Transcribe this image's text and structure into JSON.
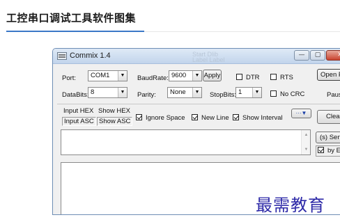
{
  "page": {
    "title": "工控串口调试工具软件图集",
    "accent_color": "#3b78c7"
  },
  "window": {
    "title": "Commix 1.4",
    "icon": "terminal-app-icon",
    "controls": {
      "minimize": "—",
      "maximize": "▢",
      "close": "✕"
    },
    "ghost_text": "Start Dlib\nLabel Label"
  },
  "settings": {
    "port_label": "Port:",
    "port_value": "COM1",
    "baud_label": "BaudRate:",
    "baud_value": "9600",
    "apply_label": "Apply",
    "dtr_label": "DTR",
    "dtr_checked": false,
    "rts_label": "RTS",
    "rts_checked": false,
    "open_label": "Open Port",
    "databits_label": "DataBits:",
    "databits_value": "8",
    "parity_label": "Parity:",
    "parity_value": "None",
    "stopbits_label": "StopBits:",
    "stopbits_value": "1",
    "nocrc_label": "No CRC",
    "nocrc_checked": false,
    "pause_label": "Pause"
  },
  "options": {
    "input_hex": "Input HEX",
    "show_hex": "Show HEX",
    "input_asc": "Input ASC",
    "show_asc": "Show ASC",
    "ignore_space_label": "Ignore Space",
    "ignore_space_checked": true,
    "new_line_label": "New Line",
    "new_line_checked": true,
    "show_interval_label": "Show Interval",
    "show_interval_checked": true,
    "more_label": "···▼",
    "clear_label": "Clear"
  },
  "send": {
    "send_label": "(s) Send",
    "by_enter_label": "by Enter",
    "by_enter_checked": true
  },
  "watermark": "最需教育"
}
